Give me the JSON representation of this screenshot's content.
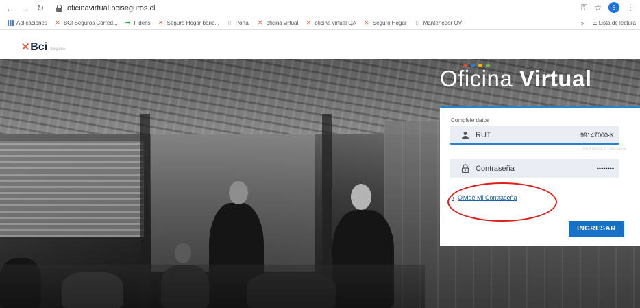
{
  "browser": {
    "url": "oficinavirtual.bciseguros.cl",
    "avatar_letter": "6",
    "bookmarks": [
      {
        "icon": "apps-grid-icon",
        "label": "Aplicaciones"
      },
      {
        "icon": "bci-logo-icon",
        "label": "BCI Seguros Corred..."
      },
      {
        "icon": "arrow-icon",
        "label": "Fidens"
      },
      {
        "icon": "bci-logo-icon",
        "label": "Seguro Hogar banc..."
      },
      {
        "icon": "page-icon",
        "label": "Portal"
      },
      {
        "icon": "bci-logo-icon",
        "label": "oficina virtual"
      },
      {
        "icon": "bci-logo-icon",
        "label": "oficina virtual QA"
      },
      {
        "icon": "bci-logo-icon",
        "label": "Seguro Hogar"
      },
      {
        "icon": "page-icon",
        "label": "Mantenedor OV"
      }
    ],
    "reading_list": "Lista de lectura",
    "more": "»"
  },
  "site": {
    "logo_text": "Bci",
    "logo_sub": "Seguros",
    "title_light": "Oficina",
    "title_bold": "Virtual"
  },
  "login": {
    "heading": "Complete datos",
    "rut_label": "RUT",
    "rut_value": "99147000-K",
    "rut_hint": "SIN PUNTOS Y CON GUION",
    "password_label": "Contraseña",
    "password_value": "••••••••",
    "forgot_link": "Olvidé Mi Contraseña",
    "submit": "INGRESAR"
  },
  "colors": {
    "accent": "#2c82c9",
    "button": "#1671c8",
    "annotation": "#e0201c",
    "dots": [
      "#e64a2e",
      "#2c82c9",
      "#f4b400",
      "#6abf4b"
    ]
  }
}
